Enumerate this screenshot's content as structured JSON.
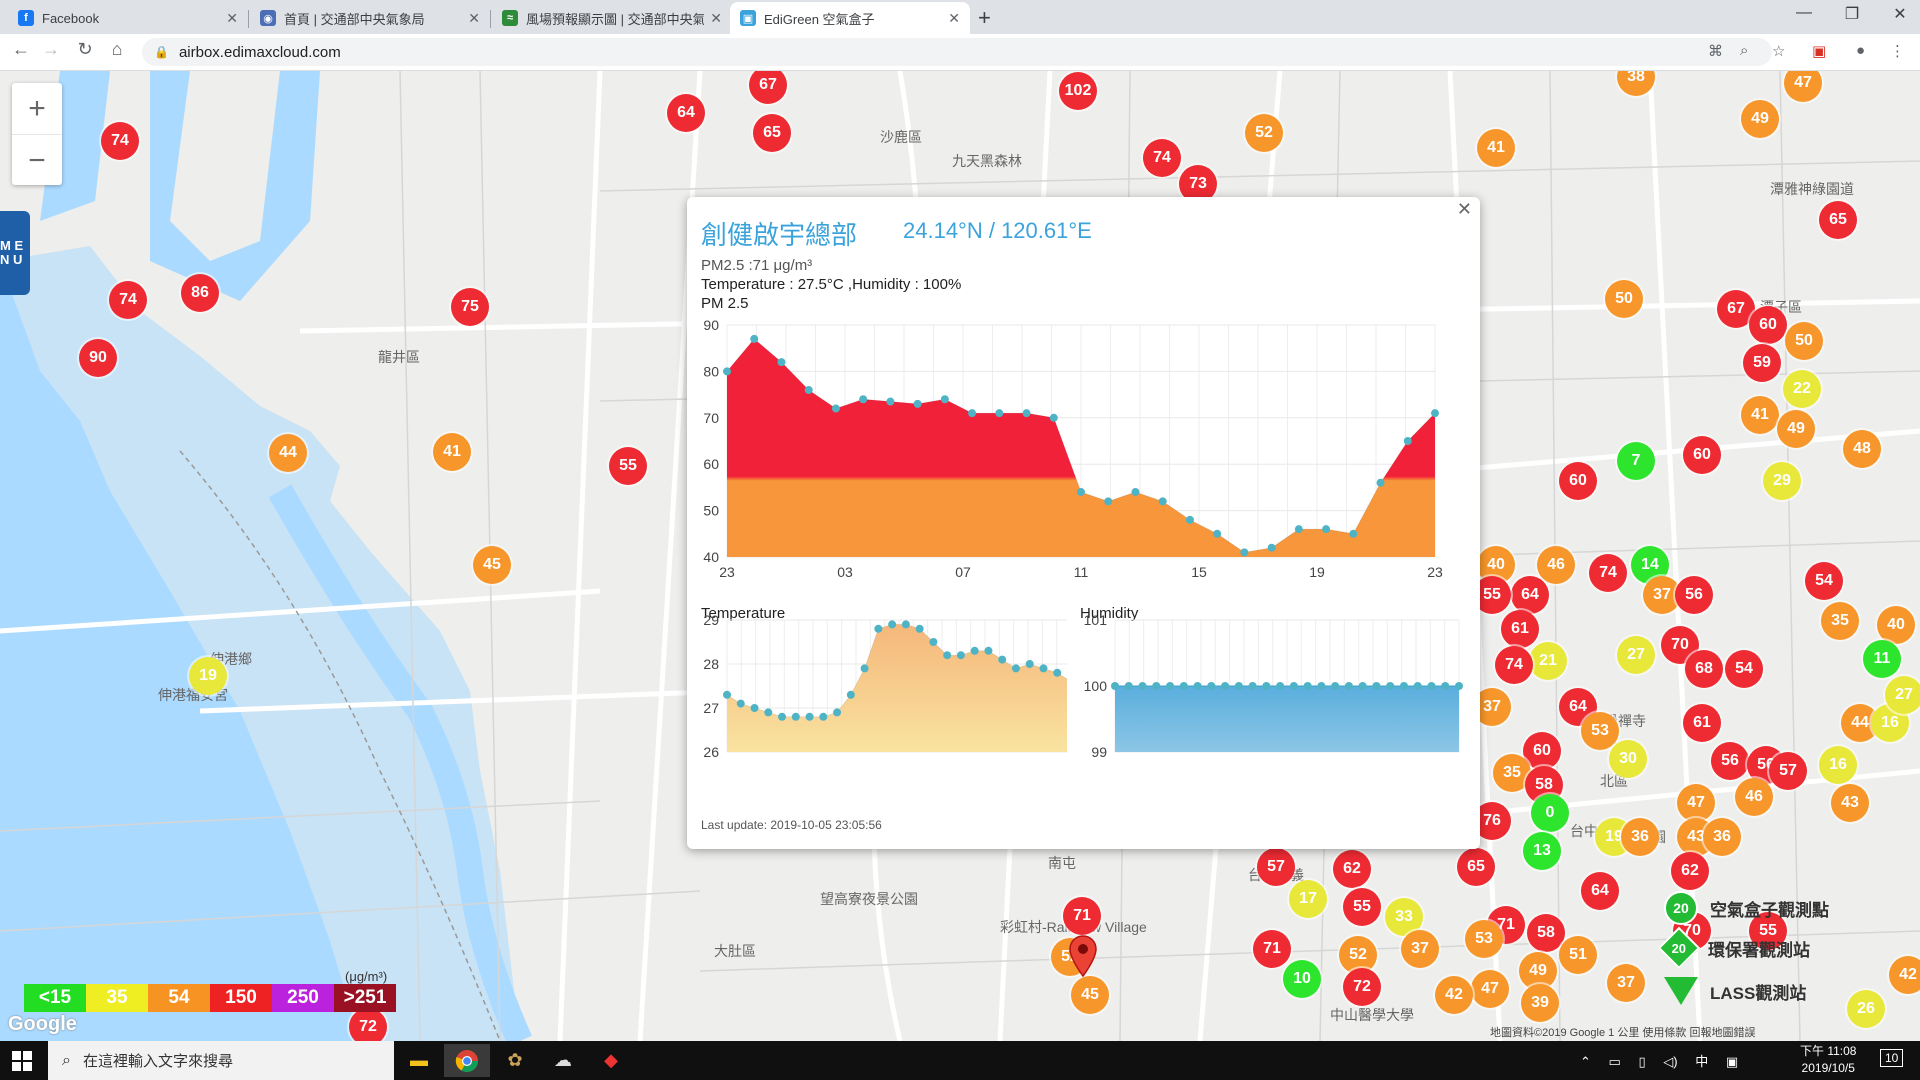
{
  "browser": {
    "tabs": [
      {
        "title": "Facebook",
        "icon": "facebook-icon",
        "color": "#1877f2",
        "active": false
      },
      {
        "title": "首頁 | 交通部中央氣象局",
        "icon": "cwb-eye-icon",
        "color": "#4b6fb5",
        "active": false
      },
      {
        "title": "風場預報顯示圖 | 交通部中央氣象局",
        "icon": "wind-map-icon",
        "color": "#2e8b3a",
        "active": false
      },
      {
        "title": "EdiGreen 空氣盒子",
        "icon": "edigreen-icon",
        "color": "#3aa3dc",
        "active": true
      }
    ],
    "url": "airbox.edimaxcloud.com"
  },
  "map": {
    "labels": [
      {
        "text": "沙鹿區",
        "x": 880,
        "y": 56
      },
      {
        "text": "九天黑森林",
        "x": 952,
        "y": 80
      },
      {
        "text": "龍井區",
        "x": 378,
        "y": 276
      },
      {
        "text": "伸港鄉",
        "x": 210,
        "y": 578
      },
      {
        "text": "伸港福安宮",
        "x": 158,
        "y": 614
      },
      {
        "text": "潭雅神綠園道",
        "x": 1770,
        "y": 108
      },
      {
        "text": "潭子區",
        "x": 1760,
        "y": 226
      },
      {
        "text": "望高寮夜景公園",
        "x": 820,
        "y": 818
      },
      {
        "text": "大肚區",
        "x": 714,
        "y": 870
      },
      {
        "text": "彩虹村-Rainbow Village",
        "x": 1000,
        "y": 846
      },
      {
        "text": "南屯",
        "x": 1048,
        "y": 782
      },
      {
        "text": "台中市",
        "x": 1570,
        "y": 750
      },
      {
        "text": "北區",
        "x": 1600,
        "y": 700
      },
      {
        "text": "台中公園",
        "x": 1610,
        "y": 756
      },
      {
        "text": "寶覺禪寺",
        "x": 1590,
        "y": 640
      },
      {
        "text": "中山醫學大學",
        "x": 1330,
        "y": 934
      },
      {
        "text": "台中嘉義",
        "x": 1248,
        "y": 794
      }
    ],
    "markers": [
      {
        "v": "74",
        "x": 120,
        "y": 70
      },
      {
        "v": "74",
        "x": 128,
        "y": 229
      },
      {
        "v": "86",
        "x": 200,
        "y": 222
      },
      {
        "v": "90",
        "x": 98,
        "y": 287
      },
      {
        "v": "75",
        "x": 470,
        "y": 236
      },
      {
        "v": "44",
        "x": 288,
        "y": 382
      },
      {
        "v": "41",
        "x": 452,
        "y": 381
      },
      {
        "v": "55",
        "x": 628,
        "y": 395
      },
      {
        "v": "45",
        "x": 492,
        "y": 494
      },
      {
        "v": "19",
        "x": 208,
        "y": 605
      },
      {
        "v": "64",
        "x": 686,
        "y": 42
      },
      {
        "v": "67",
        "x": 768,
        "y": 14
      },
      {
        "v": "65",
        "x": 772,
        "y": 62
      },
      {
        "v": "102",
        "x": 1078,
        "y": 20
      },
      {
        "v": "74",
        "x": 1162,
        "y": 87
      },
      {
        "v": "73",
        "x": 1198,
        "y": 113
      },
      {
        "v": "52",
        "x": 1264,
        "y": 62
      },
      {
        "v": "41",
        "x": 1496,
        "y": 77
      },
      {
        "v": "38",
        "x": 1636,
        "y": 6
      },
      {
        "v": "47",
        "x": 1803,
        "y": 12
      },
      {
        "v": "49",
        "x": 1760,
        "y": 48
      },
      {
        "v": "65",
        "x": 1838,
        "y": 149
      },
      {
        "v": "50",
        "x": 1624,
        "y": 228
      },
      {
        "v": "67",
        "x": 1736,
        "y": 238
      },
      {
        "v": "60",
        "x": 1768,
        "y": 254
      },
      {
        "v": "50",
        "x": 1804,
        "y": 270
      },
      {
        "v": "59",
        "x": 1762,
        "y": 292
      },
      {
        "v": "22",
        "x": 1802,
        "y": 318
      },
      {
        "v": "41",
        "x": 1760,
        "y": 344
      },
      {
        "v": "49",
        "x": 1796,
        "y": 358
      },
      {
        "v": "48",
        "x": 1862,
        "y": 378
      },
      {
        "v": "7",
        "x": 1636,
        "y": 390
      },
      {
        "v": "60",
        "x": 1702,
        "y": 384
      },
      {
        "v": "60",
        "x": 1578,
        "y": 410
      },
      {
        "v": "29",
        "x": 1782,
        "y": 410
      },
      {
        "v": "40",
        "x": 1496,
        "y": 494
      },
      {
        "v": "46",
        "x": 1556,
        "y": 494
      },
      {
        "v": "74",
        "x": 1608,
        "y": 502
      },
      {
        "v": "14",
        "x": 1650,
        "y": 494
      },
      {
        "v": "37",
        "x": 1662,
        "y": 524
      },
      {
        "v": "56",
        "x": 1694,
        "y": 524
      },
      {
        "v": "54",
        "x": 1824,
        "y": 510
      },
      {
        "v": "35",
        "x": 1840,
        "y": 550
      },
      {
        "v": "40",
        "x": 1896,
        "y": 554
      },
      {
        "v": "11",
        "x": 1882,
        "y": 588
      },
      {
        "v": "64",
        "x": 1530,
        "y": 524
      },
      {
        "v": "61",
        "x": 1520,
        "y": 558
      },
      {
        "v": "55",
        "x": 1492,
        "y": 524
      },
      {
        "v": "70",
        "x": 1680,
        "y": 574
      },
      {
        "v": "27",
        "x": 1636,
        "y": 584
      },
      {
        "v": "21",
        "x": 1548,
        "y": 590
      },
      {
        "v": "74",
        "x": 1514,
        "y": 594
      },
      {
        "v": "68",
        "x": 1704,
        "y": 598
      },
      {
        "v": "54",
        "x": 1744,
        "y": 598
      },
      {
        "v": "37",
        "x": 1492,
        "y": 636
      },
      {
        "v": "64",
        "x": 1578,
        "y": 636
      },
      {
        "v": "53",
        "x": 1600,
        "y": 660
      },
      {
        "v": "61",
        "x": 1702,
        "y": 652
      },
      {
        "v": "56",
        "x": 1730,
        "y": 690
      },
      {
        "v": "44",
        "x": 1860,
        "y": 652
      },
      {
        "v": "16",
        "x": 1890,
        "y": 652
      },
      {
        "v": "27",
        "x": 1904,
        "y": 624
      },
      {
        "v": "60",
        "x": 1542,
        "y": 680
      },
      {
        "v": "35",
        "x": 1512,
        "y": 702
      },
      {
        "v": "30",
        "x": 1628,
        "y": 688
      },
      {
        "v": "56",
        "x": 1766,
        "y": 694
      },
      {
        "v": "57",
        "x": 1788,
        "y": 700
      },
      {
        "v": "16",
        "x": 1838,
        "y": 694
      },
      {
        "v": "43",
        "x": 1850,
        "y": 732
      },
      {
        "v": "46",
        "x": 1754,
        "y": 726
      },
      {
        "v": "47",
        "x": 1696,
        "y": 732
      },
      {
        "v": "58",
        "x": 1544,
        "y": 714
      },
      {
        "v": "76",
        "x": 1492,
        "y": 750
      },
      {
        "v": "0",
        "x": 1550,
        "y": 742
      },
      {
        "v": "13",
        "x": 1542,
        "y": 780
      },
      {
        "v": "19",
        "x": 1614,
        "y": 766
      },
      {
        "v": "36",
        "x": 1640,
        "y": 766
      },
      {
        "v": "43",
        "x": 1696,
        "y": 766
      },
      {
        "v": "36",
        "x": 1722,
        "y": 766
      },
      {
        "v": "65",
        "x": 1476,
        "y": 796
      },
      {
        "v": "64",
        "x": 1600,
        "y": 820
      },
      {
        "v": "62",
        "x": 1690,
        "y": 800
      },
      {
        "v": "57",
        "x": 1276,
        "y": 796
      },
      {
        "v": "62",
        "x": 1352,
        "y": 798
      },
      {
        "v": "17",
        "x": 1308,
        "y": 828
      },
      {
        "v": "55",
        "x": 1362,
        "y": 836
      },
      {
        "v": "33",
        "x": 1404,
        "y": 846
      },
      {
        "v": "71",
        "x": 1506,
        "y": 854
      },
      {
        "v": "58",
        "x": 1546,
        "y": 862
      },
      {
        "v": "53",
        "x": 1484,
        "y": 868
      },
      {
        "v": "51",
        "x": 1578,
        "y": 884
      },
      {
        "v": "70",
        "x": 1692,
        "y": 860
      },
      {
        "v": "55",
        "x": 1768,
        "y": 860
      },
      {
        "v": "71",
        "x": 1272,
        "y": 878
      },
      {
        "v": "52",
        "x": 1358,
        "y": 884
      },
      {
        "v": "37",
        "x": 1420,
        "y": 878
      },
      {
        "v": "49",
        "x": 1538,
        "y": 900
      },
      {
        "v": "47",
        "x": 1490,
        "y": 918
      },
      {
        "v": "37",
        "x": 1626,
        "y": 912
      },
      {
        "v": "10",
        "x": 1302,
        "y": 908
      },
      {
        "v": "72",
        "x": 1362,
        "y": 916
      },
      {
        "v": "42",
        "x": 1454,
        "y": 924
      },
      {
        "v": "39",
        "x": 1540,
        "y": 932
      },
      {
        "v": "42",
        "x": 1908,
        "y": 904
      },
      {
        "v": "26",
        "x": 1866,
        "y": 938
      },
      {
        "v": "52",
        "x": 1070,
        "y": 886
      },
      {
        "v": "45",
        "x": 1090,
        "y": 924
      },
      {
        "v": "71",
        "x": 1082,
        "y": 845
      },
      {
        "v": "72",
        "x": 368,
        "y": 956
      }
    ],
    "legend": [
      {
        "label": "<15",
        "color": "#22dd22"
      },
      {
        "label": "35",
        "color": "#eeee22"
      },
      {
        "label": "54",
        "color": "#f79322"
      },
      {
        "label": "150",
        "color": "#ee2222"
      },
      {
        "label": "250",
        "color": "#bb22dd"
      },
      {
        "label": ">251",
        "color": "#991122"
      }
    ],
    "legend_unit": "(μg/m³)",
    "google_logo": "Google",
    "station_legend": [
      {
        "label": "空氣盒子觀測點",
        "icon": "airbox-station-icon"
      },
      {
        "label": "環保署觀測站",
        "icon": "epa-station-icon"
      },
      {
        "label": "LASS觀測站",
        "icon": "lass-station-icon"
      }
    ],
    "station_sample_value": "20",
    "attribution": "地圖資料©2019 Google    1 公里    使用條款    回報地圖錯誤",
    "menu_label": "M E N U"
  },
  "popup": {
    "title": "創健啟宇總部",
    "coords": "24.14°N / 120.61°E",
    "pm25_line": "PM2.5 :71 μg/m³",
    "temp_line": "Temperature : 27.5°C ,Humidity : 100%",
    "pm25_chart_title": "PM 2.5",
    "temp_chart_title": "Temperature",
    "hum_chart_title": "Humidity",
    "last_update": "Last update: 2019-10-05 23:05:56"
  },
  "chart_data": [
    {
      "type": "area",
      "title": "PM 2.5",
      "ylim": [
        40,
        90
      ],
      "yticks": [
        40,
        50,
        60,
        70,
        80,
        90
      ],
      "xticks": [
        "23",
        "03",
        "07",
        "11",
        "15",
        "19",
        "23"
      ],
      "threshold": 58,
      "colors": {
        "above": "#f2213a",
        "below": "#f7963a"
      },
      "values": [
        80,
        87,
        82,
        76,
        72,
        74,
        73.5,
        73,
        74,
        71,
        71,
        71,
        70,
        54,
        52,
        54,
        52,
        48,
        45,
        41,
        42,
        46,
        46,
        45,
        56,
        65,
        71
      ]
    },
    {
      "type": "area",
      "title": "Temperature",
      "ylim": [
        26,
        29
      ],
      "yticks": [
        26,
        27,
        28,
        29
      ],
      "values": [
        27.3,
        27.1,
        27.0,
        26.9,
        26.8,
        26.8,
        26.8,
        26.8,
        26.9,
        27.3,
        27.9,
        28.8,
        28.9,
        28.9,
        28.8,
        28.5,
        28.2,
        28.2,
        28.3,
        28.3,
        28.1,
        27.9,
        28.0,
        27.9,
        27.8,
        27.6
      ]
    },
    {
      "type": "area",
      "title": "Humidity",
      "ylim": [
        99,
        101
      ],
      "yticks": [
        99,
        100,
        101
      ],
      "values": [
        100,
        100,
        100,
        100,
        100,
        100,
        100,
        100,
        100,
        100,
        100,
        100,
        100,
        100,
        100,
        100,
        100,
        100,
        100,
        100,
        100,
        100,
        100,
        100,
        100,
        100
      ]
    }
  ],
  "taskbar": {
    "search_placeholder": "在這裡輸入文字來搜尋",
    "clock_time": "下午 11:08",
    "clock_date": "2019/10/5",
    "ime": "中",
    "notifications": "10"
  }
}
